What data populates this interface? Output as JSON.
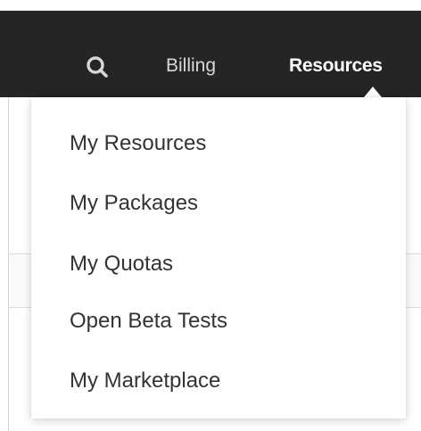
{
  "nav": {
    "search_icon": "search-icon",
    "billing_label": "Billing",
    "resources_label": "Resources"
  },
  "dropdown": {
    "items": [
      {
        "label": "My Resources"
      },
      {
        "label": "My Packages"
      },
      {
        "label": "My Quotas"
      },
      {
        "label": "Open Beta Tests"
      },
      {
        "label": "My Marketplace"
      }
    ]
  },
  "colors": {
    "topbar": "#252525",
    "nav_text": "#d8d8d8",
    "nav_active": "#ffffff",
    "menu_text": "#333333"
  }
}
